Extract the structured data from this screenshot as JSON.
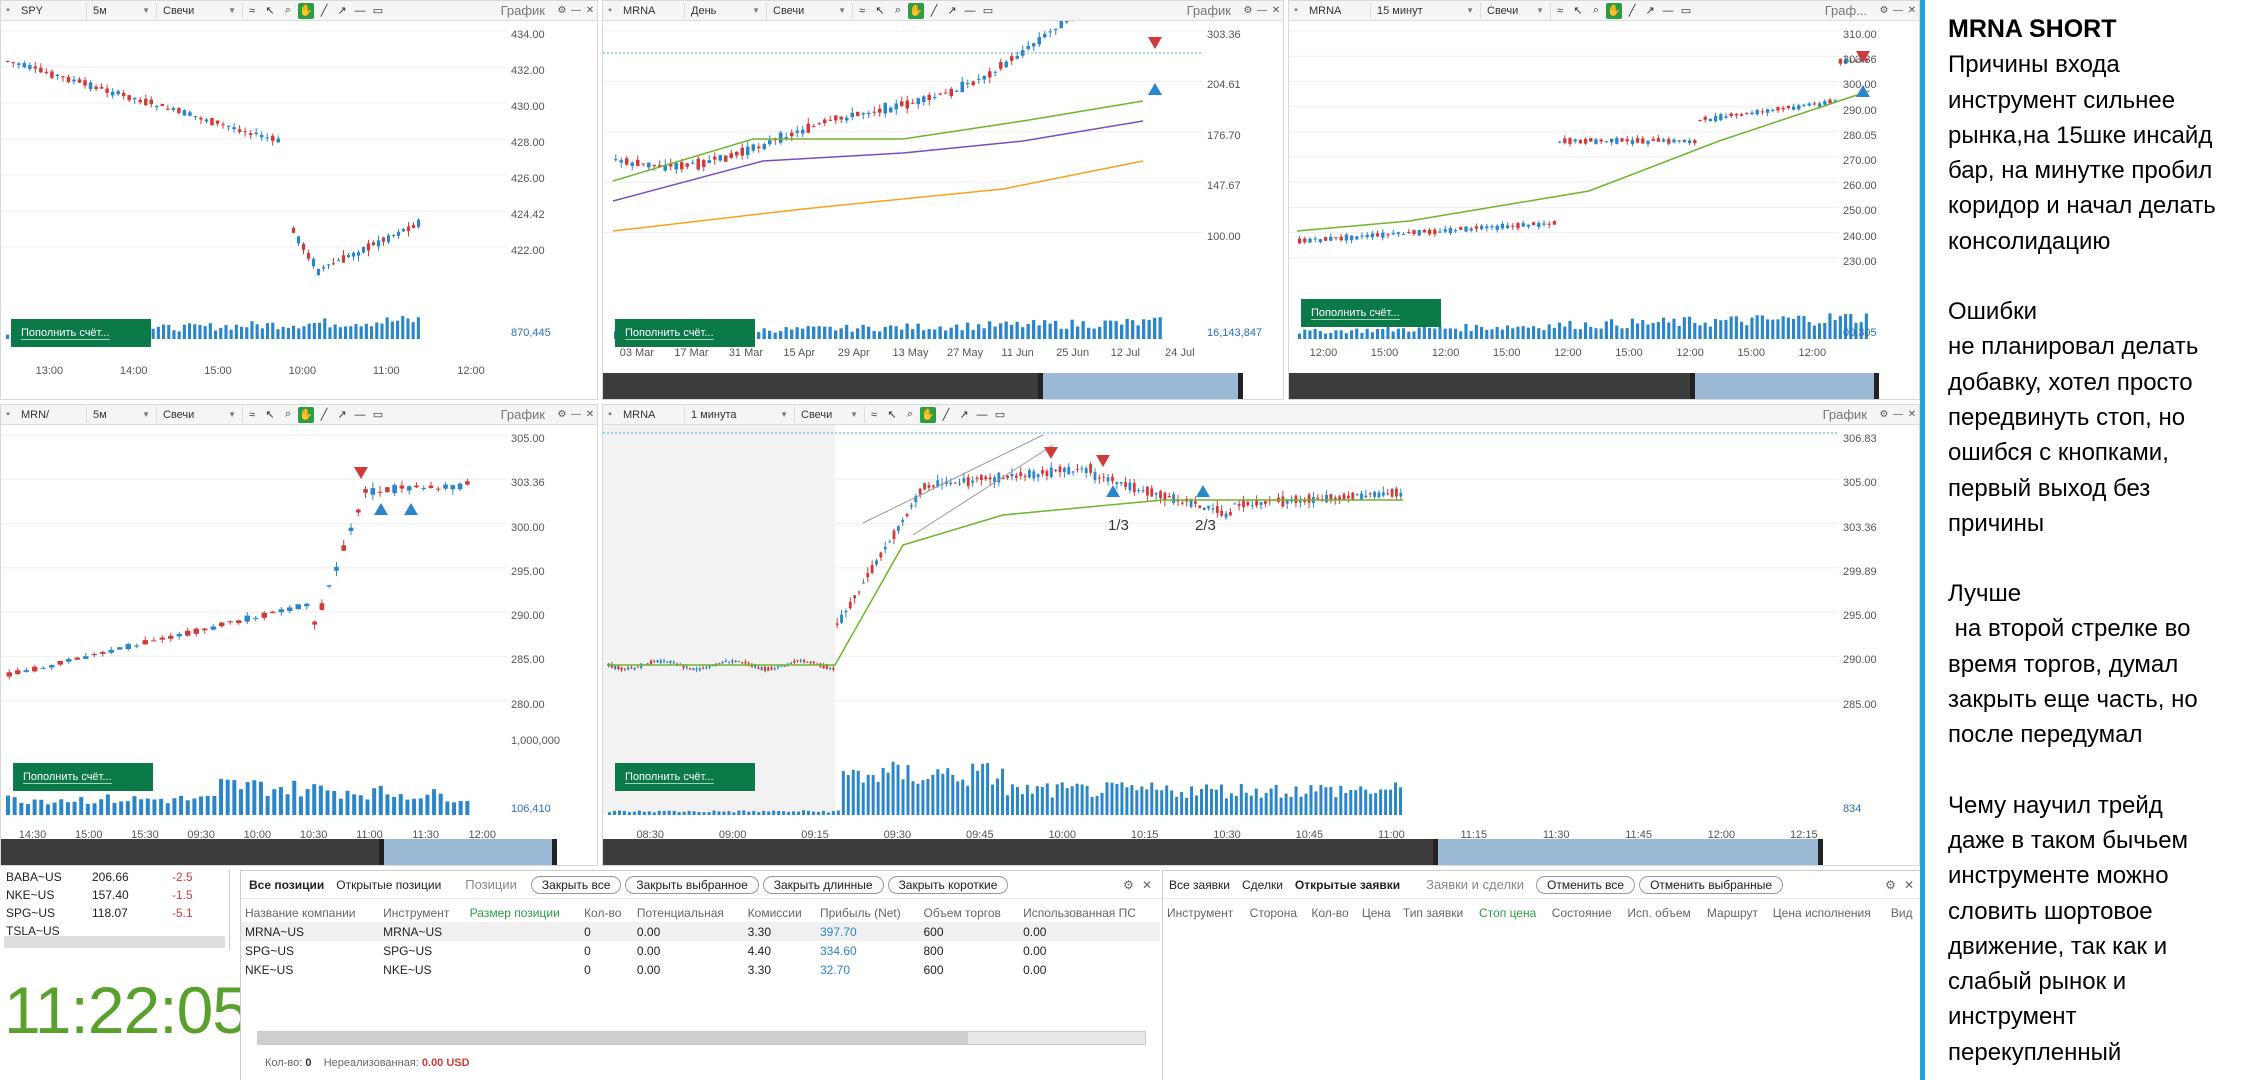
{
  "colors": {
    "up": "#2a85c9",
    "down": "#d23a3a",
    "ma_green": "#6fb42c",
    "ma_purple": "#7a4dbf",
    "ma_orange": "#f5a31a",
    "topup": "#0b7a48",
    "clock": "#5aa02c"
  },
  "panels": {
    "spy": {
      "symbol": "SPY",
      "interval": "5м",
      "type": "Свечи",
      "title": "График",
      "prices": [
        "434.00",
        "432.00",
        "430.00",
        "428.00",
        "426.00",
        "424.42",
        "422.00"
      ],
      "volume": "870,445",
      "times": [
        "13:00",
        "14:00",
        "15:00",
        "10:00",
        "11:00",
        "12:00"
      ],
      "topup": "Пополнить счёт..."
    },
    "mrna_day": {
      "symbol": "MRNA",
      "interval": "День",
      "type": "Свечи",
      "title": "График",
      "prices": [
        "303.36",
        "204.61",
        "176.70",
        "147.67",
        "100.00"
      ],
      "volume": "16,143,847",
      "times": [
        "03 Mar",
        "17 Mar",
        "31 Mar",
        "15 Apr",
        "29 Apr",
        "13 May",
        "27 May",
        "11 Jun",
        "25 Jun",
        "12 Jul",
        "24 Jul"
      ],
      "topup": "Пополнить счёт..."
    },
    "mrna_15": {
      "symbol": "MRNA",
      "interval": "15 минут",
      "type": "Свечи",
      "title": "Граф...",
      "prices": [
        "310.00",
        "303.36",
        "300.00",
        "290.00",
        "280.05",
        "270.00",
        "260.00",
        "250.00",
        "240.00",
        "230.00"
      ],
      "volume": "00,305",
      "times": [
        "12:00",
        "15:00",
        "12:00",
        "15:00",
        "12:00",
        "15:00",
        "12:00",
        "15:00",
        "12:00"
      ],
      "topup": "Пополнить счёт..."
    },
    "mrna_5": {
      "symbol": "MRN/",
      "interval": "5м",
      "type": "Свечи",
      "title": "График",
      "prices": [
        "305.00",
        "303.36",
        "300.00",
        "295.00",
        "290.00",
        "285.00",
        "280.00"
      ],
      "volume_max": "1,000,000",
      "volume": "106,410",
      "times": [
        "14:30",
        "15:00",
        "15:30",
        "09:30",
        "10:00",
        "10:30",
        "11:00",
        "11:30",
        "12:00"
      ],
      "topup": "Пополнить счёт..."
    },
    "mrna_1": {
      "symbol": "MRNA",
      "interval": "1 минута",
      "type": "Свечи",
      "title": "График",
      "prices": [
        "306.83",
        "305.00",
        "303.36",
        "299.89",
        "295.00",
        "290.00",
        "285.00"
      ],
      "volume": "834",
      "times": [
        "08:30",
        "09:00",
        "09:15",
        "09:30",
        "09:45",
        "10:00",
        "10:15",
        "10:30",
        "10:45",
        "11:00",
        "11:15",
        "11:30",
        "11:45",
        "12:00",
        "12:15"
      ],
      "labels": [
        "1/3",
        "2/3"
      ],
      "topup": "Пополнить счёт..."
    }
  },
  "watchlist": [
    {
      "sym": "BABA~US",
      "price": "206.66",
      "chg": "-2.5"
    },
    {
      "sym": "NKE~US",
      "price": "157.40",
      "chg": "-1.5"
    },
    {
      "sym": "SPG~US",
      "price": "118.07",
      "chg": "-5.1"
    },
    {
      "sym": "TSLA~US",
      "price": "",
      "chg": ""
    }
  ],
  "clock": "11:22:05",
  "positions": {
    "tabs": [
      "Все позиции",
      "Открытые позиции"
    ],
    "title": "Позиции",
    "buttons": [
      "Закрыть все",
      "Закрыть выбранное",
      "Закрыть длинные",
      "Закрыть короткие"
    ],
    "headers": [
      "Название компании",
      "Инструмент",
      "Размер позиции",
      "Кол-во",
      "Потенциальная",
      "Комиссии",
      "Прибыль (Net)",
      "Объем торгов",
      "Использованная ПС"
    ],
    "rows": [
      [
        "MRNA~US",
        "MRNA~US",
        "",
        "0",
        "0.00",
        "3.30",
        "397.70",
        "600",
        "0.00"
      ],
      [
        "SPG~US",
        "SPG~US",
        "",
        "0",
        "0.00",
        "4.40",
        "334.60",
        "800",
        "0.00"
      ],
      [
        "NKE~US",
        "NKE~US",
        "",
        "0",
        "0.00",
        "3.30",
        "32.70",
        "600",
        "0.00"
      ]
    ],
    "footer_qty_label": "Кол-во:",
    "footer_qty": "0",
    "footer_unreal_label": "Нереализованная:",
    "footer_unreal": "0.00 USD"
  },
  "orders": {
    "tabs": [
      "Все заявки",
      "Сделки",
      "Открытые заявки"
    ],
    "title": "Заявки и сделки",
    "buttons": [
      "Отменить все",
      "Отменить выбранные"
    ],
    "headers": [
      "Инструмент",
      "Сторона",
      "Кол-во",
      "Цена",
      "Тип заявки",
      "Стоп цена",
      "Состояние",
      "Исп. объем",
      "Маршрут",
      "Цена исполнения",
      "Вид"
    ]
  },
  "note": {
    "title": "MRNA SHORT",
    "s1": [
      "Причины входа",
      "инструмент сильнее",
      "рынка,на 15шке инсайд",
      "бар, на минутке пробил",
      "коридор и начал делать",
      "консолидацию"
    ],
    "s2": [
      "Ошибки",
      "не планировал делать",
      "добавку, хотел просто",
      "передвинуть стоп, но",
      "ошибся с кнопками,",
      "первый выход без",
      "причины"
    ],
    "s3": [
      "Лучше",
      " на второй стрелке во",
      "время торгов, думал",
      "закрыть еще часть, но",
      "после передумал"
    ],
    "s4": [
      "Чему научил трейд",
      "даже в таком бычьем",
      "инструменте можно",
      "словить шортовое",
      "движение, так как и",
      "слабый рынок и",
      "инструмент",
      "перекупленный"
    ]
  }
}
